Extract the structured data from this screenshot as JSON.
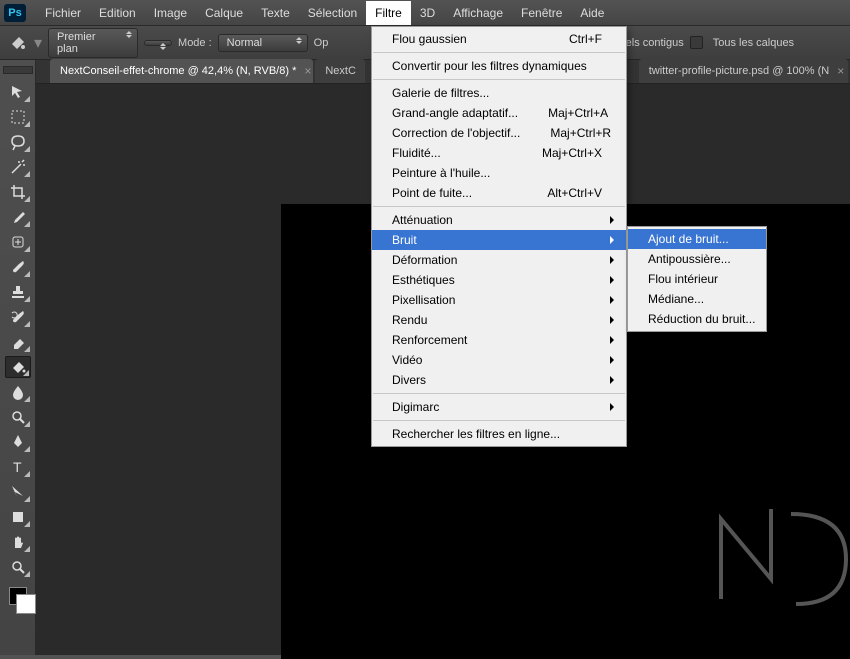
{
  "menubar": [
    "Fichier",
    "Edition",
    "Image",
    "Calque",
    "Texte",
    "Sélection",
    "Filtre",
    "3D",
    "Affichage",
    "Fenêtre",
    "Aide"
  ],
  "menubar_open_index": 6,
  "options": {
    "foreground_label": "Premier plan",
    "mode_label": "Mode :",
    "mode_value": "Normal",
    "op_label": "Op",
    "pixels_label": "Pixels contigus",
    "all_layers_label": "Tous les calques"
  },
  "tabs": [
    {
      "label": "NextConseil-effet-chrome @ 42,4% (N, RVB/8) *",
      "active": true
    },
    {
      "label": "NextC",
      "active": false
    },
    {
      "label": "twitter-profile-picture.psd @ 100% (N",
      "active": false,
      "closable": true
    }
  ],
  "tools": [
    {
      "name": "move-tool"
    },
    {
      "name": "marquee-tool"
    },
    {
      "name": "lasso-tool"
    },
    {
      "name": "wand-tool"
    },
    {
      "name": "crop-tool"
    },
    {
      "name": "eyedropper-tool"
    },
    {
      "name": "heal-tool"
    },
    {
      "name": "brush-tool"
    },
    {
      "name": "stamp-tool"
    },
    {
      "name": "history-brush-tool"
    },
    {
      "name": "eraser-tool"
    },
    {
      "name": "bucket-tool",
      "active": true
    },
    {
      "name": "blur-tool"
    },
    {
      "name": "dodge-tool"
    },
    {
      "name": "pen-tool"
    },
    {
      "name": "type-tool"
    },
    {
      "name": "path-tool"
    },
    {
      "name": "shape-tool"
    },
    {
      "name": "hand-tool"
    },
    {
      "name": "zoom-tool"
    }
  ],
  "filter_menu": [
    {
      "label": "Flou gaussien",
      "shortcut": "Ctrl+F"
    },
    {
      "sep": true
    },
    {
      "label": "Convertir pour les filtres dynamiques"
    },
    {
      "sep": true
    },
    {
      "label": "Galerie de filtres..."
    },
    {
      "label": "Grand-angle adaptatif...",
      "shortcut": "Maj+Ctrl+A"
    },
    {
      "label": "Correction de l'objectif...",
      "shortcut": "Maj+Ctrl+R"
    },
    {
      "label": "Fluidité...",
      "shortcut": "Maj+Ctrl+X"
    },
    {
      "label": "Peinture à l'huile..."
    },
    {
      "label": "Point de fuite...",
      "shortcut": "Alt+Ctrl+V"
    },
    {
      "sep": true
    },
    {
      "label": "Atténuation",
      "sub": true
    },
    {
      "label": "Bruit",
      "sub": true,
      "highlight": true
    },
    {
      "label": "Déformation",
      "sub": true
    },
    {
      "label": "Esthétiques",
      "sub": true
    },
    {
      "label": "Pixellisation",
      "sub": true
    },
    {
      "label": "Rendu",
      "sub": true
    },
    {
      "label": "Renforcement",
      "sub": true
    },
    {
      "label": "Vidéo",
      "sub": true
    },
    {
      "label": "Divers",
      "sub": true
    },
    {
      "sep": true
    },
    {
      "label": "Digimarc",
      "sub": true
    },
    {
      "sep": true
    },
    {
      "label": "Rechercher les filtres en ligne..."
    }
  ],
  "bruit_submenu": [
    {
      "label": "Ajout de bruit...",
      "highlight": true
    },
    {
      "label": "Antipoussière..."
    },
    {
      "label": "Flou intérieur"
    },
    {
      "label": "Médiane..."
    },
    {
      "label": "Réduction du bruit..."
    }
  ]
}
